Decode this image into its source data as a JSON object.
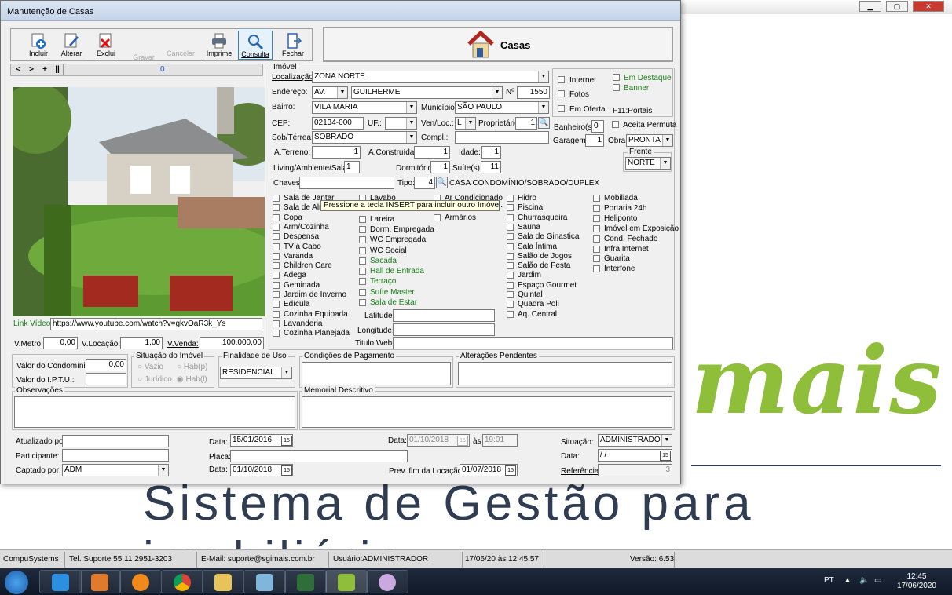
{
  "bg": {
    "title": "",
    "mais": "mais",
    "slogan": "Sistema de Gestão para imobiliária"
  },
  "window": {
    "title": "Manutenção de Casas"
  },
  "toolbar": {
    "incluir": "Incluir",
    "alterar": "Alterar",
    "excluir": "Exclui",
    "gravar": "Gravar",
    "cancelar": "Cancelar",
    "imprime": "Imprime",
    "consulta": "Consulta",
    "fechar": "Fechar"
  },
  "header": {
    "title": "Casas"
  },
  "nav": {
    "prev": "<",
    "next": ">",
    "plus": "+",
    "pipe": "||",
    "record": "0"
  },
  "imovel": {
    "group_label": "Imóvel",
    "localizacao_label": "Localização:",
    "localizacao": "ZONA NORTE",
    "endereco_label": "Endereço:",
    "endereco_tipo": "AV.",
    "endereco": "GUILHERME",
    "num_label": "Nº",
    "num": "1550",
    "bairro_label": "Bairro:",
    "bairro": "VILA MARIA",
    "municipio_label": "Município:",
    "municipio": "SÃO PAULO",
    "cep_label": "CEP:",
    "cep": "02134-000",
    "uf_label": "UF.:",
    "uf": "",
    "venloc_label": "Ven/Loc.:",
    "venloc": "L",
    "proprietario_label": "Proprietário:",
    "proprietario": "1",
    "sobterrea_label": "Sob/Térrea:",
    "sobterrea": "SOBRADO",
    "compl_label": "Compl.:",
    "compl": "",
    "aterreno_label": "A.Terreno:",
    "aterreno": "1",
    "aconstruida_label": "A.Construída:",
    "aconstruida": "1",
    "idade_label": "Idade:",
    "idade": "1",
    "living_label": "Living/Ambiente/Sala:",
    "living": "1",
    "dormitorio_label": "Dormitório:",
    "dormitorio": "1",
    "suites_label": "Suíte(s):",
    "suites": "11",
    "chaves_label": "Chaves:",
    "chaves": "",
    "tipo_label": "Tipo:",
    "tipo": "4",
    "tipo_desc": "CASA CONDOMÍNIO/SOBRADO/DUPLEX"
  },
  "flags": {
    "internet": "Internet",
    "fotos": "Fotos",
    "emoferta": "Em Oferta",
    "emdestaque": "Em Destaque",
    "banner": "Banner",
    "f11": "F11:Portais"
  },
  "right": {
    "banheiros_label": "Banheiro(s):",
    "banheiros": "0",
    "aceita": "Aceita Permuta",
    "garagem_label": "Garagem:",
    "garagem": "1",
    "obra_label": "Obra:",
    "obra": "PRONTA",
    "frente_label": "Frente",
    "frente": "NORTE"
  },
  "tooltip": "Pressione a tecla INSERT para incluir outro Imóvel.",
  "feat1": [
    "Sala de Jantar",
    "Sala de Almoço",
    "Copa",
    "Arm/Cozinha",
    "Despensa",
    "TV à Cabo",
    "Varanda",
    "Children Care",
    "Adega",
    "Geminada",
    "Jardim de Inverno",
    "Edícula",
    "Cozinha Equipada",
    "Lavanderia",
    "Cozinha Planejada"
  ],
  "feat2": [
    "Lavabo",
    "",
    "Lareira",
    "Dorm. Empregada",
    "WC Empregada",
    "WC Social",
    "Sacada",
    "Hall de Entrada",
    "Terraço",
    "Suíte Master",
    "Sala de Estar"
  ],
  "feat3": [
    "Ar Condicionado",
    "",
    "Armários"
  ],
  "feat4": [
    "Hidro",
    "Piscina",
    "Churrasqueira",
    "Sauna",
    "Sala de Ginastica",
    "Sala Íntima",
    "Salão de Jogos",
    "Salão de Festa",
    "Jardim",
    "Espaço Gourmet",
    "Quintal",
    "Quadra Poli",
    "Aq. Central"
  ],
  "feat5": [
    "Mobiliada",
    "Portaria 24h",
    "Heliponto",
    "Imóvel em Exposição",
    "Cond. Fechado",
    "Infra Internet",
    "Guarita",
    "Interfone"
  ],
  "geo": {
    "latitude_label": "Latitude:",
    "latitude": "",
    "longitude_label": "Longitude:",
    "longitude": "",
    "tituloweb_label": "Titulo Web:",
    "tituloweb": ""
  },
  "video": {
    "label": "Link Vídeo:",
    "url": "https://www.youtube.com/watch?v=gkvOaR3k_Ys"
  },
  "valores": {
    "vmetro_label": "V.Metro:",
    "vmetro": "0,00",
    "vlocacao_label": "V.Locação:",
    "vlocacao": "1,00",
    "vvenda_label": "V.Venda:",
    "vvenda": "100.000,00"
  },
  "cond": {
    "condominio_label": "Valor do Condomínio:",
    "condominio": "0,00",
    "iptu_label": "Valor do I.P.T.U.:",
    "iptu": ""
  },
  "situacao": {
    "label": "Situação do Imóvel",
    "vazio": "Vazio",
    "habp": "Hab(p)",
    "juridico": "Jurídico",
    "habl": "Hab(l)"
  },
  "finalidade": {
    "label": "Finalidade de Uso",
    "value": "RESIDENCIAL"
  },
  "cond_pag": "Condições de Pagamento",
  "alt_pend": "Alterações Pendentes",
  "observacoes": "Observações",
  "memorial": "Memorial Descritivo",
  "footer": {
    "atualizado_label": "Atualizado por:",
    "atualizado": "",
    "participante_label": "Participante:",
    "participante": "",
    "captado_label": "Captado por:",
    "captado": "ADM",
    "data1_label": "Data:",
    "data1": "15/01/2016",
    "placa_label": "Placa:",
    "placa": "",
    "data2_label": "Data:",
    "data2": "01/10/2018",
    "data3_label": "Data:",
    "data3": "01/10/2018",
    "as_label": "às",
    "hora": "19:01",
    "prevfim_label": "Prev. fim  da Locação:",
    "prevfim": "01/07/2018",
    "situacao_label": "Situação:",
    "situacao": "ADMINISTRADO",
    "data4_label": "Data:",
    "data4": " /  /",
    "referencia_label": "Referência:",
    "referencia": "3"
  },
  "status": {
    "company": "CompuSystems",
    "tel": "Tel. Suporte 55 11 2951-3203",
    "email": "E-Mail: suporte@sgimais.com.br",
    "usuario": "Usuário:ADMINISTRADOR",
    "datahora": "17/06/20 às 12:45:57",
    "versao": "Versão: 6.53"
  },
  "taskbar": {
    "lang": "PT",
    "time": "12:45",
    "date": "17/06/2020"
  }
}
